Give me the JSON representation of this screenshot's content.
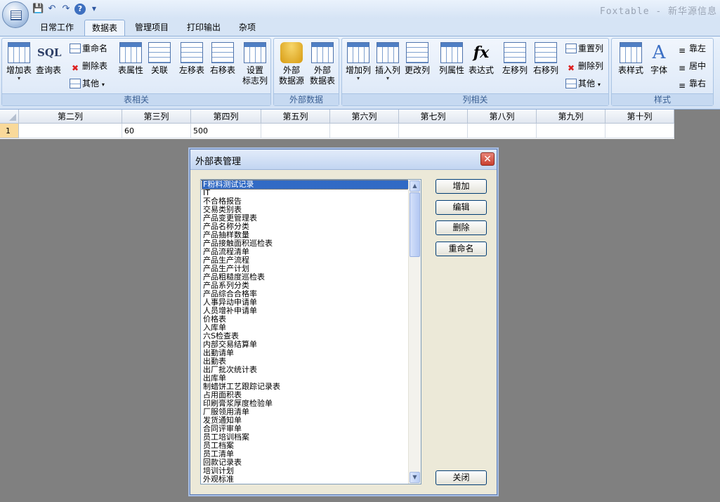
{
  "window": {
    "title": "Foxtable - 新华源信息"
  },
  "tabs": [
    "日常工作",
    "数据表",
    "管理项目",
    "打印输出",
    "杂项"
  ],
  "ribbon": {
    "groups": {
      "table": "表相关",
      "external": "外部数据",
      "column": "列相关",
      "style": "样式"
    },
    "buttons": {
      "add_table": "增加表",
      "query_table": "查询表",
      "rename": "重命名",
      "delete_table": "删除表",
      "other1": "其他",
      "table_props": "表属性",
      "relation": "关联",
      "move_left_table": "左移表",
      "move_right_table": "右移表",
      "set_flag_col_1": "设置",
      "set_flag_col_2": "标志列",
      "ext_source_1": "外部",
      "ext_source_2": "数据源",
      "ext_table_1": "外部",
      "ext_table_2": "数据表",
      "add_col": "增加列",
      "insert_col": "插入列",
      "modify_col": "更改列",
      "col_props": "列属性",
      "expression": "表达式",
      "move_left_col": "左移列",
      "move_right_col": "右移列",
      "reset_col": "重置列",
      "delete_col": "删除列",
      "other2": "其他",
      "table_style": "表样式",
      "font": "字体",
      "align_left": "靠左",
      "align_center": "居中",
      "align_right": "靠右"
    }
  },
  "grid": {
    "columns": [
      "第二列",
      "第三列",
      "第四列",
      "第五列",
      "第六列",
      "第七列",
      "第八列",
      "第九列",
      "第十列"
    ],
    "rows": [
      {
        "num": "1",
        "cells": [
          "",
          "60",
          "500",
          "",
          "",
          "",
          "",
          "",
          ""
        ]
      }
    ]
  },
  "dialog": {
    "title": "外部表管理",
    "selected_index": 0,
    "items": [
      "F粉料测试记录",
      "IT",
      "不合格报告",
      "交易类别表",
      "产品变更管理表",
      "产品名称分类",
      "产品抽样数量",
      "产品接触面积巡检表",
      "产品流程清单",
      "产品生产流程",
      "产品生产计划",
      "产品粗糙度巡检表",
      "产品系列分类",
      "产品综合合格率",
      "人事异动申请单",
      "人员增补申请单",
      "价格表",
      "入库单",
      "六S检查表",
      "内部交易结算单",
      "出勤请单",
      "出勤表",
      "出厂批次统计表",
      "出库单",
      "制蜡饼工艺跟踪记录表",
      "占用面积表",
      "印刷膏浆厚度检验单",
      "厂服领用清单",
      "发货通知单",
      "合同评审单",
      "员工培训档案",
      "员工档案",
      "员工清单",
      "回款记录表",
      "培训计划",
      "外观标准"
    ],
    "buttons": {
      "add": "增加",
      "edit": "编辑",
      "delete": "删除",
      "rename": "重命名",
      "close": "关闭"
    }
  }
}
